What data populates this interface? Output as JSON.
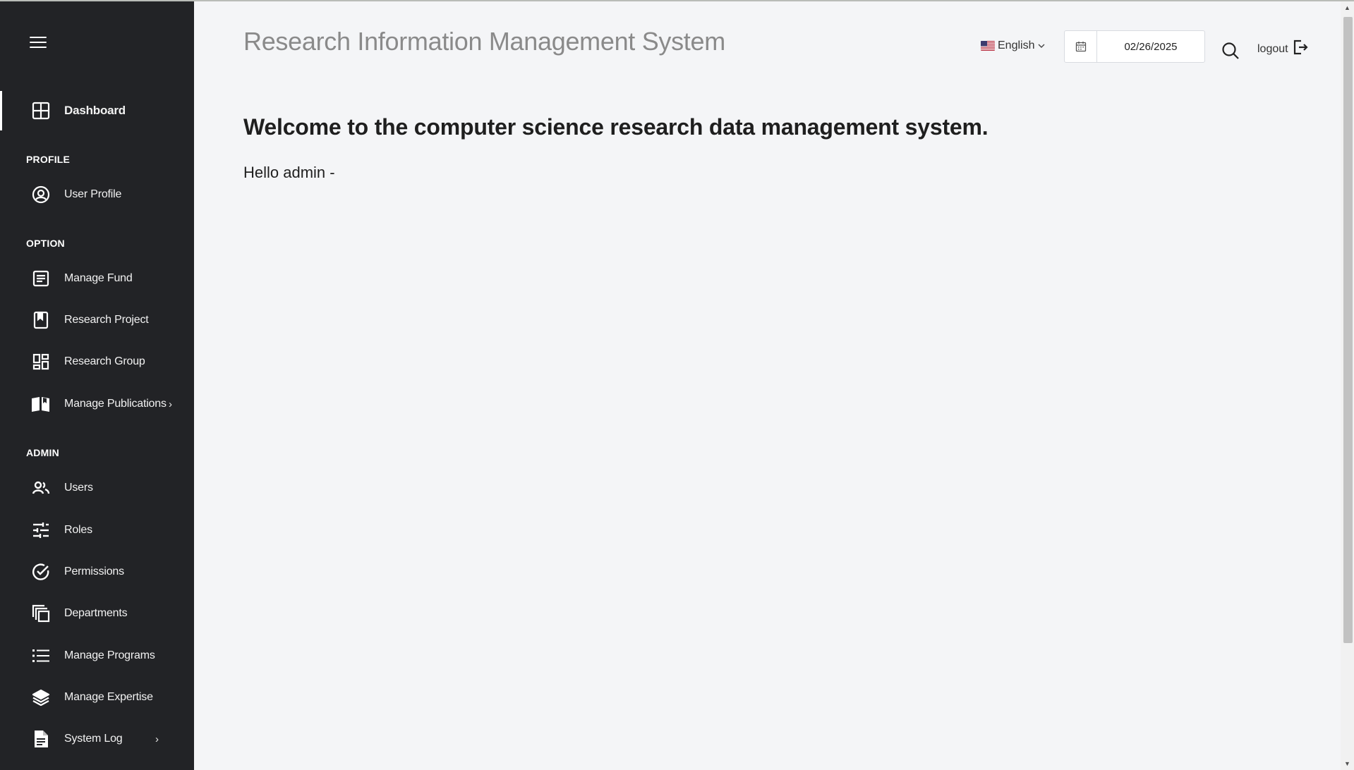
{
  "app": {
    "title": "Research Information Management System"
  },
  "sidebar": {
    "dashboard": {
      "label": "Dashboard",
      "icon": "dashboard-grid-icon"
    },
    "sections": {
      "profile": "PROFILE",
      "option": "OPTION",
      "admin": "ADMIN"
    },
    "profile_items": [
      {
        "label": "User Profile",
        "icon": "user-circle-icon"
      }
    ],
    "option_items": [
      {
        "label": "Manage Fund",
        "icon": "document-list-icon"
      },
      {
        "label": "Research Project",
        "icon": "bookmark-icon"
      },
      {
        "label": "Research Group",
        "icon": "widgets-icon"
      },
      {
        "label": "Manage Publications",
        "icon": "book-open-icon",
        "chevron": "›"
      }
    ],
    "admin_items": [
      {
        "label": "Users",
        "icon": "users-icon"
      },
      {
        "label": "Roles",
        "icon": "sliders-icon"
      },
      {
        "label": "Permissions",
        "icon": "check-circle-icon"
      },
      {
        "label": "Departments",
        "icon": "copy-squares-icon"
      },
      {
        "label": "Manage Programs",
        "icon": "list-icon"
      },
      {
        "label": "Manage Expertise",
        "icon": "layers-icon"
      },
      {
        "label": "System Log",
        "icon": "file-text-icon",
        "chevron": "›"
      }
    ]
  },
  "header": {
    "language": "English",
    "date": "02/26/2025",
    "logout": "logout"
  },
  "content": {
    "welcome": "Welcome to the computer science research data management system.",
    "greeting": "Hello admin -"
  },
  "colors": {
    "sidebar_bg": "#222326",
    "page_bg": "#f4f5f7",
    "title_gray": "#8a8a8a"
  }
}
